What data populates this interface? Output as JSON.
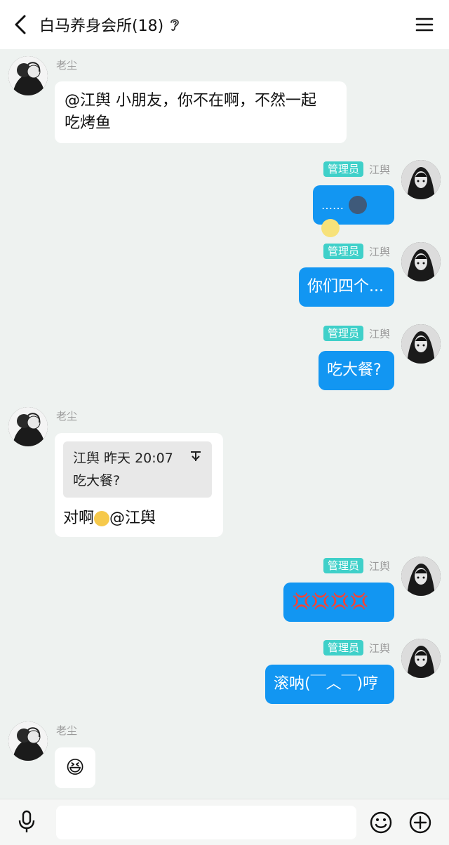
{
  "header": {
    "title": "白马养身会所(18)",
    "back_icon": "chevron-left-icon",
    "ear_icon": "ear-icon",
    "menu_icon": "hamburger-menu-icon"
  },
  "messages": [
    {
      "sender": "老尘",
      "text": "@江舆 小朋友，你不在啊，不然一起\n吃烤鱼"
    },
    {
      "badge": "管理员",
      "sender": "江舆",
      "text": "……"
    },
    {
      "badge": "管理员",
      "sender": "江舆",
      "text": "你们四个..."
    },
    {
      "badge": "管理员",
      "sender": "江舆",
      "text": "吃大餐?"
    },
    {
      "sender": "老尘",
      "quote_header": "江舆 昨天 20:07",
      "quote_text": "吃大餐?",
      "text": "对啊",
      "text2": "@江舆"
    },
    {
      "badge": "管理员",
      "sender": "江舆",
      "text": "💢💢💢💢"
    },
    {
      "badge": "管理员",
      "sender": "江舆",
      "text": "滚呐(￣︿￣)哼"
    },
    {
      "sender": "老尘",
      "emoji": "😆"
    }
  ],
  "bottom": {
    "mic_icon": "microphone-icon",
    "input_placeholder": "",
    "emoji_icon": "smiley-icon",
    "plus_icon": "plus-circle-icon"
  },
  "colors": {
    "background": "#eef2f0",
    "outgoing_bubble": "#1296f2",
    "incoming_bubble": "#ffffff",
    "admin_badge": "#3fd0c9"
  }
}
